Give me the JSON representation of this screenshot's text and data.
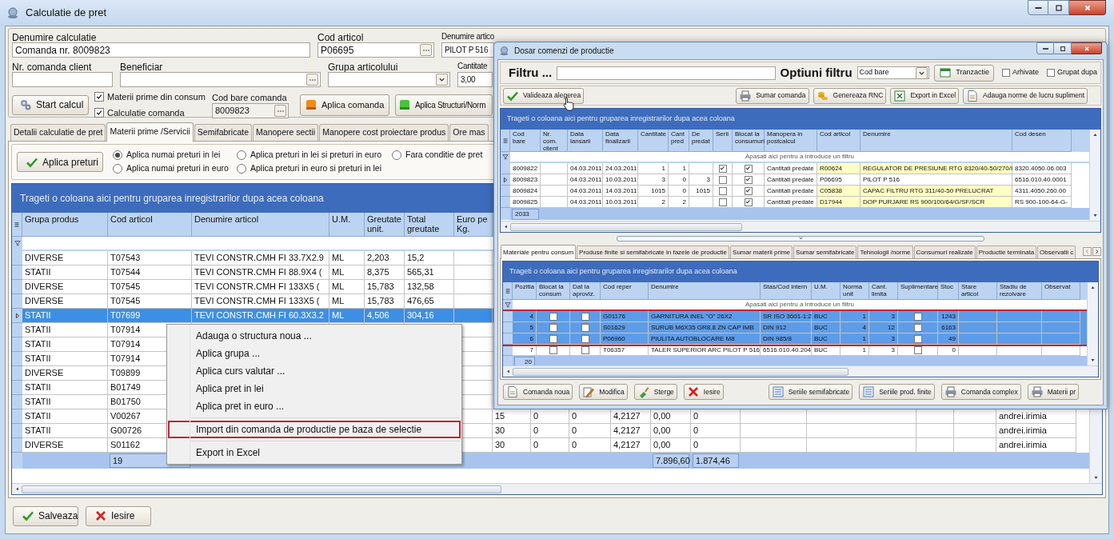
{
  "window": {
    "title": "Calculatie de pret"
  },
  "form": {
    "fields": [
      {
        "label": "Denumire calculatie",
        "value": "Comanda nr. 8009823",
        "kind": "text"
      },
      {
        "label": "Cod articol",
        "value": "P06695",
        "kind": "lookup"
      },
      {
        "label": "Denumire artico",
        "value": "PILOT P 516",
        "kind": "text"
      },
      {
        "label": "Nr. comanda client",
        "kind": "text"
      },
      {
        "label": "Beneficiar",
        "kind": "lookup"
      },
      {
        "label": "Grupa articolului",
        "kind": "dropdown"
      },
      {
        "label": "Cantitate",
        "value": "3,00",
        "kind": "text"
      }
    ],
    "start_button": "Start calcul",
    "checkboxes": [
      {
        "label": "Materii prime din consum",
        "checked": true
      },
      {
        "label": "Calculatie comanda",
        "checked": true
      }
    ],
    "barcode": {
      "label": "Cod bare comanda",
      "value": "8009823"
    },
    "action_buttons": [
      "Aplica comanda",
      "Aplica Structuri/Norm"
    ]
  },
  "tabs": [
    {
      "label": "Detalii calculatie de pret",
      "selected": false
    },
    {
      "label": "Materii prime /Servicii",
      "selected": true
    },
    {
      "label": "Semifabricate",
      "selected": false
    },
    {
      "label": "Manopere sectii",
      "selected": false
    },
    {
      "label": "Manopere cost proiectare produs",
      "selected": false
    },
    {
      "label": "Ore mas",
      "selected": false
    }
  ],
  "prices": {
    "apply_button": "Aplica preturi",
    "radios": [
      {
        "label": "Aplica numai preturi in lei",
        "selected": true
      },
      {
        "label": "Aplica numai preturi in euro",
        "selected": false
      },
      {
        "label": "Aplica preturi in lei si preturi in euro",
        "selected": false
      },
      {
        "label": "Aplica preturi in euro si preturi in lei",
        "selected": false
      },
      {
        "label": "Fara conditie de pret",
        "selected": false
      }
    ]
  },
  "grid": {
    "group_hint": "Trageti o coloana aici pentru gruparea inregistrarilor dupa acea coloana",
    "columns": [
      "Grupa produs",
      "Cod articol",
      "Denumire articol",
      "U.M.",
      "Greutate unit.",
      "Total greutate",
      "Euro pe Kg."
    ],
    "rows": [
      {
        "cells": [
          "DIVERSE",
          "T07543",
          "TEVI CONSTR.CMH FI 33.7X2.9",
          "ML",
          "2,203",
          "15,2"
        ],
        "selected": false
      },
      {
        "cells": [
          "STATII",
          "T07544",
          "TEVI CONSTR.CMH FI 88.9X4 (",
          "ML",
          "8,375",
          "565,31"
        ],
        "selected": false
      },
      {
        "cells": [
          "DIVERSE",
          "T07545",
          "TEVI CONSTR.CMH FI 133X5 (",
          "ML",
          "15,783",
          "132,58"
        ],
        "selected": false
      },
      {
        "cells": [
          "DIVERSE",
          "T07545",
          "TEVI CONSTR.CMH FI 133X5 (",
          "ML",
          "15,783",
          "476,65"
        ],
        "selected": false
      },
      {
        "cells": [
          "STATII",
          "T07699",
          "TEVI CONSTR.CMH FI 60.3X3.2",
          "ML",
          "4,506",
          "304,16"
        ],
        "selected": true
      },
      {
        "cells": [
          "STATII",
          "T07914"
        ],
        "selected": false
      },
      {
        "cells": [
          "STATII",
          "T07914"
        ],
        "selected": false
      },
      {
        "cells": [
          "STATII",
          "T07914"
        ],
        "selected": false
      },
      {
        "cells": [
          "DIVERSE",
          "T09899"
        ],
        "selected": false
      },
      {
        "cells": [
          "STATII",
          "B01749"
        ],
        "selected": false
      },
      {
        "cells": [
          "STATII",
          "B01750"
        ],
        "selected": false
      },
      {
        "cells": [
          "STATII",
          "V00267"
        ],
        "extra": [
          "15",
          "0",
          "0",
          "4,2127",
          "0,00",
          "0"
        ],
        "user": "andrei.irimia",
        "selected": false
      },
      {
        "cells": [
          "STATII",
          "G00726"
        ],
        "extra": [
          "30",
          "0",
          "0",
          "4,2127",
          "0,00",
          "0"
        ],
        "user": "andrei.irimia",
        "selected": false
      },
      {
        "cells": [
          "DIVERSE",
          "S01162"
        ],
        "extra": [
          "30",
          "0",
          "0",
          "4,2127",
          "0,00",
          "0"
        ],
        "user": "andrei.irimia",
        "selected": false
      }
    ],
    "footer": {
      "count": "19",
      "totals": [
        "7.896,60",
        "1.874,46"
      ]
    }
  },
  "context_menu": [
    {
      "kind": "item",
      "label": "Adauga o structura noua ...",
      "marked": false
    },
    {
      "kind": "item",
      "label": "Aplica grupa ...",
      "marked": false
    },
    {
      "kind": "item",
      "label": "Aplica curs valutar ...",
      "marked": false
    },
    {
      "kind": "item",
      "label": "Aplica pret in lei",
      "marked": false
    },
    {
      "kind": "item",
      "label": "Aplica pret in euro ...",
      "marked": false
    },
    {
      "kind": "separator"
    },
    {
      "kind": "item",
      "label": "Import din comanda de productie pe baza de selectie",
      "marked": true
    },
    {
      "kind": "separator"
    },
    {
      "kind": "item",
      "label": "Export in Excel",
      "marked": false
    }
  ],
  "bottom_buttons": [
    "Salveaza",
    "Iesire"
  ],
  "dialog": {
    "title": "Dosar comenzi de productie",
    "filter": {
      "label": "Filtru ...",
      "options_label": "Optiuni filtru",
      "option": "Cod bare",
      "button": "Tranzactie",
      "checkboxes": [
        {
          "label": "Arhivate",
          "checked": false
        },
        {
          "label": "Grupat dupa",
          "checked": false
        }
      ]
    },
    "toolbar": [
      "Valideaza alegerea",
      "Sumar comanda",
      "Genereaza RNC",
      "Export in Excel",
      "Adauga norme de lucru supliment"
    ],
    "orders": {
      "group_hint": "Trageti o coloana aici pentru gruparea inregistrarilor dupa acea coloana",
      "filter_hint": "Apasati aici pentru a introduce un filtru",
      "columns": [
        {
          "label": "Cod bare",
          "kind": "text"
        },
        {
          "label": "Nr. com. client",
          "kind": "text"
        },
        {
          "label": "Data lansarii",
          "kind": "text"
        },
        {
          "label": "Data finalizarii",
          "kind": "text"
        },
        {
          "label": "Cantitate",
          "kind": "number"
        },
        {
          "label": "Cant pred",
          "kind": "number"
        },
        {
          "label": "De predat",
          "kind": "number"
        },
        {
          "label": "Serii",
          "kind": "check"
        },
        {
          "label": "Blocat la consumuri",
          "kind": "check"
        },
        {
          "label": "Manopera in postcalcul",
          "kind": "text"
        },
        {
          "label": "Cod articol",
          "kind": "article"
        },
        {
          "label": "Denumire",
          "kind": "article"
        },
        {
          "label": "Cod desen",
          "kind": "text"
        }
      ],
      "rows": [
        {
          "cells": [
            "8009822",
            null,
            "04.03.2011",
            "24.03.2011",
            "1",
            "1",
            null,
            true,
            true,
            "Cantitati predate",
            "R00624",
            "REGULATOR DE PRESIUNE RTG 8320/40-50/270/I",
            "8320.4050.06.003"
          ],
          "current": false,
          "highlighted": true
        },
        {
          "cells": [
            "8009823",
            null,
            "04.03.2011",
            "10.03.2011",
            "3",
            "0",
            "3",
            false,
            true,
            "Cantitati predate",
            "P06695",
            "PILOT P 516",
            "6516.010.40.0001"
          ],
          "current": true,
          "highlighted": false
        },
        {
          "cells": [
            "8009824",
            null,
            "04.03.2011",
            "14.03.2011",
            "1015",
            "0",
            "1015",
            false,
            true,
            "Cantitati predate",
            "C05838",
            "CAPAC FILTRU RTG 311/40-50 PRELUCRAT",
            "4311.4050.260.00"
          ],
          "current": false,
          "highlighted": true
        },
        {
          "cells": [
            "8009825",
            null,
            "04.03.2011",
            "10.03.2011",
            "2",
            "2",
            null,
            false,
            true,
            "Cantitati predate",
            "D17944",
            "DOP PURJARE RS 900/100/64/G/SF/SCR",
            "RS 900-100-64-G-"
          ],
          "current": false,
          "highlighted": true
        }
      ],
      "footer": "2033"
    },
    "tabs": [
      {
        "label": "Materiale pentru consum",
        "selected": true
      },
      {
        "label": "Produse finite si semifabricate in fazele de productie",
        "selected": false
      },
      {
        "label": "Sumar materii prime",
        "selected": false
      },
      {
        "label": "Sumar semifabricate",
        "selected": false
      },
      {
        "label": "Tehnologii /norme",
        "selected": false
      },
      {
        "label": "Consumuri realizate",
        "selected": false
      },
      {
        "label": "Productie terminata",
        "selected": false
      },
      {
        "label": "Observatii c",
        "selected": false
      }
    ],
    "materials": {
      "group_hint": "Trageti o coloana aici pentru gruparea inregistrarilor dupa acea coloana",
      "filter_hint": "Apasati aici pentru a introduce un filtru",
      "columns": [
        {
          "label": "Pozitia",
          "kind": "number"
        },
        {
          "label": "Blocat la consum",
          "kind": "check"
        },
        {
          "label": "Dat la aproviz.",
          "kind": "check"
        },
        {
          "label": "Cod reper",
          "kind": "text"
        },
        {
          "label": "Denumire",
          "kind": "text"
        },
        {
          "label": "Stas/Cod intern",
          "kind": "text"
        },
        {
          "label": "U.M.",
          "kind": "text"
        },
        {
          "label": "Norma unit",
          "kind": "number"
        },
        {
          "label": "Cant. limita",
          "kind": "number"
        },
        {
          "label": "Suplimentare",
          "kind": "check"
        },
        {
          "label": "Stoc",
          "kind": "number"
        },
        {
          "label": "Stare articol",
          "kind": "text"
        },
        {
          "label": "Stadiu de rezolvare",
          "kind": "text"
        },
        {
          "label": "Observat",
          "kind": "text"
        }
      ],
      "rows": [
        {
          "cells": [
            "4",
            false,
            false,
            "G01176",
            "GARNITURA INEL \"O\" 26X2",
            "SR ISO 3601-1:2",
            "BUC",
            "1",
            "3",
            false,
            "1243",
            null,
            null,
            null
          ],
          "selected": true,
          "marked": true
        },
        {
          "cells": [
            "5",
            false,
            false,
            "S01629",
            "SURUB M6X35 GR8.8 ZN CAP IMB",
            "DIN 912",
            "BUC",
            "4",
            "12",
            false,
            "6163",
            null,
            null,
            null
          ],
          "selected": true,
          "marked": true
        },
        {
          "cells": [
            "6",
            false,
            false,
            "P06960",
            "PIULITA AUTOBLOCARE M8",
            "DIN 985/8",
            "BUC",
            "1",
            "3",
            false,
            "49",
            null,
            null,
            null
          ],
          "selected": true,
          "marked": true
        },
        {
          "cells": [
            "7",
            false,
            false,
            "T06357",
            "TALER SUPERIOR ARC PILOT P 516",
            "6516.010.40.204",
            "BUC",
            "1",
            "3",
            false,
            "0",
            null,
            null,
            null
          ],
          "selected": false,
          "marked": false
        }
      ],
      "footer": "20"
    },
    "buttons": [
      "Comanda noua",
      "Modifica",
      "Sterge",
      "Iesire",
      "Seriile semifabricate",
      "Seriile prod. finite",
      "Comanda complex",
      "Materii pr"
    ]
  }
}
